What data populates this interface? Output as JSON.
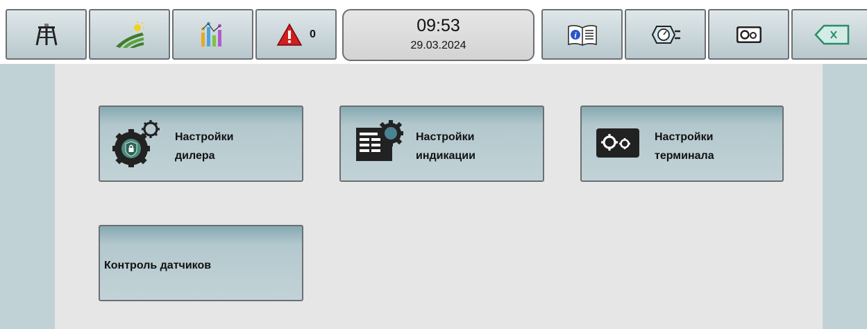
{
  "toolbar": {
    "alarm_count": "0",
    "clock_time": "09:53",
    "clock_date": "29.03.2024"
  },
  "menu": {
    "dealer_settings": {
      "line1": "Настройки",
      "line2": "дилера"
    },
    "display_settings": {
      "line1": "Настройки",
      "line2": "индикации"
    },
    "terminal_settings": {
      "line1": "Настройки",
      "line2": "терминала"
    },
    "sensor_control": {
      "label": "Контроль датчиков"
    }
  },
  "icons": [
    "machine-icon",
    "field-icon",
    "statistics-icon",
    "alarm-icon",
    "manual-icon",
    "gauge-icon",
    "settings-icon",
    "back-icon",
    "dealer-settings-icon",
    "display-settings-icon",
    "terminal-settings-icon"
  ],
  "colors": {
    "button_top": "#86a9b1",
    "button_bottom": "#c2d3d7",
    "side_panel": "#c1d2d6",
    "content_bg": "#e6e6e6",
    "alarm_red": "#d21e1e"
  }
}
